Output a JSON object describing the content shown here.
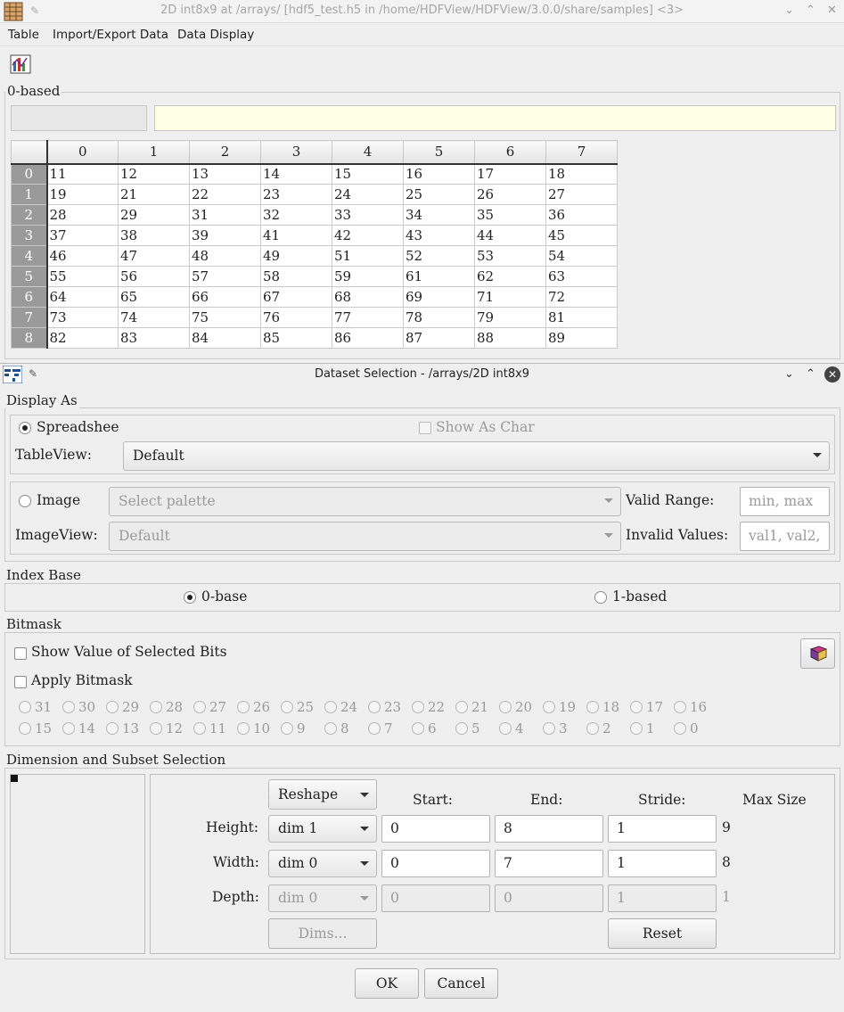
{
  "bg_window": {
    "title": "2D int8x9 at /arrays/ [hdf5_test.h5 in /home/HDFView/HDFView/3.0.0/share/samples] <3>",
    "menu": [
      "Table",
      "Import/Export Data",
      "Data Display"
    ],
    "index_group_label": "0-based",
    "table": {
      "columns": [
        "0",
        "1",
        "2",
        "3",
        "4",
        "5",
        "6",
        "7"
      ],
      "rows": [
        {
          "label": "0",
          "cells": [
            "11",
            "12",
            "13",
            "14",
            "15",
            "16",
            "17",
            "18"
          ]
        },
        {
          "label": "1",
          "cells": [
            "19",
            "21",
            "22",
            "23",
            "24",
            "25",
            "26",
            "27"
          ]
        },
        {
          "label": "2",
          "cells": [
            "28",
            "29",
            "31",
            "32",
            "33",
            "34",
            "35",
            "36"
          ]
        },
        {
          "label": "3",
          "cells": [
            "37",
            "38",
            "39",
            "41",
            "42",
            "43",
            "44",
            "45"
          ]
        },
        {
          "label": "4",
          "cells": [
            "46",
            "47",
            "48",
            "49",
            "51",
            "52",
            "53",
            "54"
          ]
        },
        {
          "label": "5",
          "cells": [
            "55",
            "56",
            "57",
            "58",
            "59",
            "61",
            "62",
            "63"
          ]
        },
        {
          "label": "6",
          "cells": [
            "64",
            "65",
            "66",
            "67",
            "68",
            "69",
            "71",
            "72"
          ]
        },
        {
          "label": "7",
          "cells": [
            "73",
            "74",
            "75",
            "76",
            "77",
            "78",
            "79",
            "81"
          ]
        },
        {
          "label": "8",
          "cells": [
            "82",
            "83",
            "84",
            "85",
            "86",
            "87",
            "88",
            "89"
          ]
        }
      ]
    }
  },
  "dialog": {
    "title": "Dataset Selection - /arrays/2D int8x9",
    "display_as": {
      "label": "Display As",
      "spreadsheet": "Spreadshee",
      "show_as_char": "Show As Char",
      "tableview_label": "TableView:",
      "tableview_value": "Default",
      "image": "Image",
      "palette_placeholder": "Select palette",
      "valid_range_label": "Valid Range:",
      "valid_range_placeholder": "min, max",
      "imageview_label": "ImageView:",
      "imageview_value": "Default",
      "invalid_values_label": "Invalid Values:",
      "invalid_values_placeholder": "val1, val2,"
    },
    "index_base": {
      "label": "Index Base",
      "zero_based": "0-base",
      "one_based": "1-based"
    },
    "bitmask": {
      "label": "Bitmask",
      "show_value": "Show Value of Selected Bits",
      "apply_bitmask": "Apply Bitmask",
      "bits_row1": [
        "31",
        "30",
        "29",
        "28",
        "27",
        "26",
        "25",
        "24",
        "23",
        "22",
        "21",
        "20",
        "19",
        "18",
        "17",
        "16"
      ],
      "bits_row2": [
        "15",
        "14",
        "13",
        "12",
        "11",
        "10",
        "9",
        "8",
        "7",
        "6",
        "5",
        "4",
        "3",
        "2",
        "1",
        "0"
      ]
    },
    "dimension": {
      "label": "Dimension and Subset Selection",
      "reshape": "Reshape",
      "start_header": "Start:",
      "end_header": "End:",
      "stride_header": "Stride:",
      "max_header": "Max Size",
      "height_label": "Height:",
      "height_dim": "dim 1",
      "height_start": "0",
      "height_end": "8",
      "height_stride": "1",
      "height_max": "9",
      "width_label": "Width:",
      "width_dim": "dim 0",
      "width_start": "0",
      "width_end": "7",
      "width_stride": "1",
      "width_max": "8",
      "depth_label": "Depth:",
      "depth_dim": "dim 0",
      "depth_start": "0",
      "depth_end": "0",
      "depth_stride": "1",
      "depth_max": "1",
      "dims_button": "Dims...",
      "reset_button": "Reset"
    },
    "ok": "OK",
    "cancel": "Cancel"
  }
}
